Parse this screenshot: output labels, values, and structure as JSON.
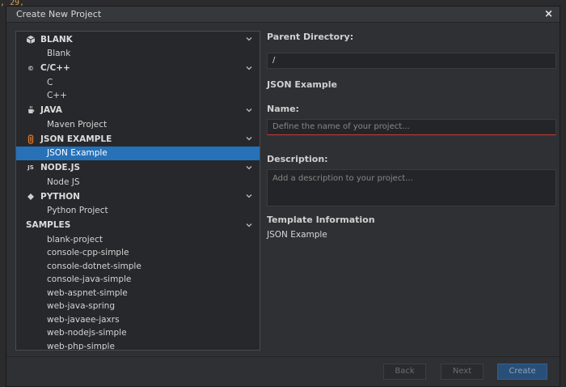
{
  "backdrop": {
    "code_fragment": ", 29,"
  },
  "dialog": {
    "title": "Create New Project",
    "close_glyph": "×"
  },
  "tree": {
    "categories": [
      {
        "label": "BLANK",
        "icon": "cube-icon",
        "items": [
          "Blank"
        ]
      },
      {
        "label": "C/C++",
        "icon": "c-language-icon",
        "items": [
          "C",
          "C++"
        ]
      },
      {
        "label": "JAVA",
        "icon": "java-cup-icon",
        "items": [
          "Maven Project"
        ]
      },
      {
        "label": "JSON EXAMPLE",
        "icon": "json-icon",
        "items": [
          "JSON Example"
        ]
      },
      {
        "label": "NODE.JS",
        "icon": "nodejs-icon",
        "items": [
          "Node JS"
        ]
      },
      {
        "label": "PYTHON",
        "icon": "python-icon",
        "items": [
          "Python Project"
        ]
      },
      {
        "label": "SAMPLES",
        "icon": "",
        "items": [
          "blank-project",
          "console-cpp-simple",
          "console-dotnet-simple",
          "console-java-simple",
          "web-aspnet-simple",
          "web-java-spring",
          "web-javaee-jaxrs",
          "web-nodejs-simple",
          "web-php-simple"
        ]
      }
    ],
    "selected_item": "JSON Example"
  },
  "form": {
    "parent_directory_label": "Parent Directory:",
    "parent_directory_value": "/",
    "selected_template_heading": "JSON Example",
    "name_label": "Name:",
    "name_placeholder": "Define the name of your project...",
    "description_label": "Description:",
    "description_placeholder": "Add a description to your project...",
    "template_info_label": "Template Information",
    "template_info_value": "JSON Example"
  },
  "footer": {
    "back_label": "Back",
    "next_label": "Next",
    "create_label": "Create"
  },
  "colors": {
    "selection": "#2671b8",
    "primary_button": "#294f78",
    "error_underline": "#c43b3b"
  }
}
